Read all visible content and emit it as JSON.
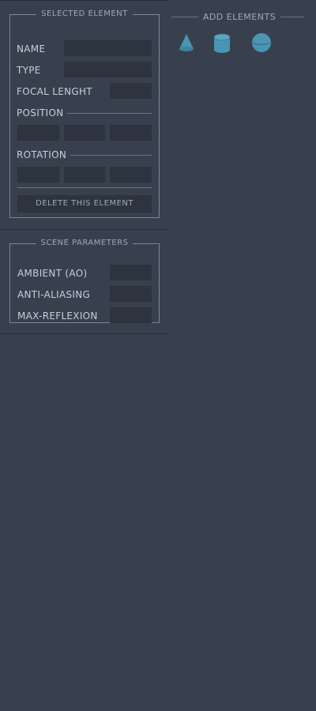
{
  "selected_element": {
    "legend": "SELECTED ELEMENT",
    "name_label": "NAME",
    "type_label": "TYPE",
    "focal_label": "FOCAL LENGHT",
    "position_label": "POSITION",
    "rotation_label": "ROTATION",
    "name_value": "",
    "type_value": "",
    "focal_value": "",
    "position_values": [
      "",
      "",
      ""
    ],
    "rotation_values": [
      "",
      "",
      ""
    ],
    "delete_label": "DELETE THIS ELEMENT"
  },
  "scene_parameters": {
    "legend": "SCENE PARAMETERS",
    "ambient_label": "AMBIENT (AO)",
    "antialiasing_label": "ANTI-ALIASING",
    "maxreflexion_label": "MAX-REFLEXION",
    "ambient_value": "",
    "antialiasing_value": "",
    "maxreflexion_value": ""
  },
  "add_elements": {
    "title": "ADD ELEMENTS",
    "shapes": [
      {
        "icon": "cone-icon"
      },
      {
        "icon": "cylinder-icon"
      },
      {
        "icon": "sphere-icon"
      }
    ]
  },
  "colors": {
    "background": "#38404e",
    "input": "#2d3440",
    "accent": "#4a95b3",
    "border": "#7d8796"
  }
}
